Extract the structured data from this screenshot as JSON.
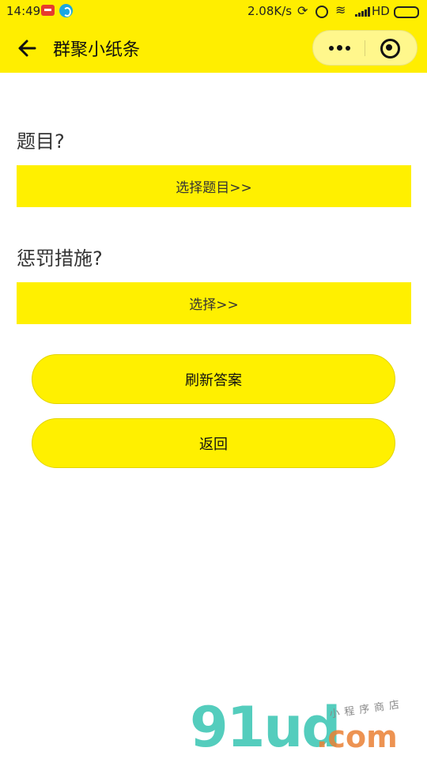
{
  "status_bar": {
    "time": "14:49",
    "net_speed": "2.08K/s",
    "network_label": "HD",
    "icons": [
      "calendar-app-icon",
      "browser-app-icon",
      "sync-off-icon",
      "alarm-icon",
      "wifi-icon",
      "signal-icon",
      "battery-icon"
    ]
  },
  "nav": {
    "title": "群聚小纸条",
    "back_icon": "arrow-left-icon",
    "more_icon": "more-dots-icon",
    "close_icon": "target-close-icon",
    "background": "#ffee00"
  },
  "question": {
    "label": "题目?",
    "select_label": "选择题目>>"
  },
  "punishment": {
    "label": "惩罚措施?",
    "select_label": "选择>>"
  },
  "actions": {
    "refresh_label": "刷新答案",
    "back_label": "返回"
  },
  "colors": {
    "accent": "#fff000"
  },
  "watermark": {
    "brand": "91ud",
    "domain": ".com",
    "tagline": "小程序商店"
  }
}
